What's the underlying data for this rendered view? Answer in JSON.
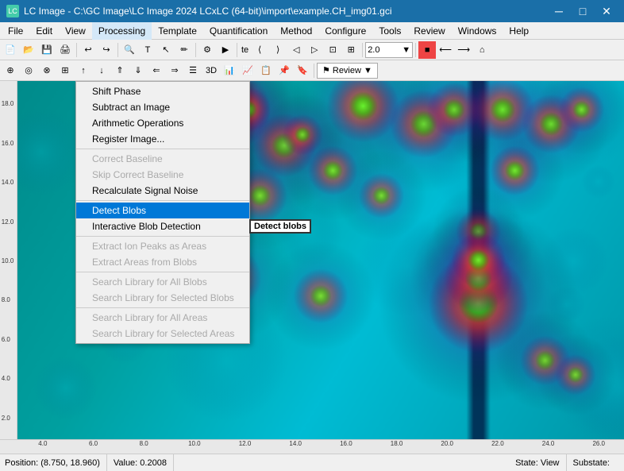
{
  "titlebar": {
    "title": "LC Image - C:\\GC Image\\LC Image 2024 LCxLC (64-bit)\\import\\example.CH_img01.gci",
    "icon": "LC",
    "minimize": "─",
    "maximize": "□",
    "close": "✕"
  },
  "menubar": {
    "items": [
      "File",
      "Edit",
      "View",
      "Processing",
      "Template",
      "Quantification",
      "Method",
      "Configure",
      "Tools",
      "Review",
      "Windows",
      "Help"
    ]
  },
  "toolbar": {
    "zoom_value": "2.0",
    "review_label": "Review"
  },
  "processing_menu": {
    "title": "Processing",
    "sections": [
      {
        "items": [
          {
            "label": "Shift Phase",
            "disabled": false
          },
          {
            "label": "Subtract an Image",
            "disabled": false
          },
          {
            "label": "Arithmetic Operations",
            "disabled": false
          },
          {
            "label": "Register Image...",
            "disabled": false
          }
        ]
      },
      {
        "items": [
          {
            "label": "Correct Baseline",
            "disabled": true
          },
          {
            "label": "Skip Correct Baseline",
            "disabled": true
          },
          {
            "label": "Recalculate Signal Noise",
            "disabled": false
          }
        ]
      },
      {
        "items": [
          {
            "label": "Detect Blobs",
            "disabled": false,
            "highlighted": true
          },
          {
            "label": "Interactive Blob Detection",
            "disabled": false,
            "tooltip": "Detect blobs"
          }
        ]
      },
      {
        "items": [
          {
            "label": "Extract Ion Peaks as Areas",
            "disabled": true
          },
          {
            "label": "Extract Areas from Blobs",
            "disabled": true
          }
        ]
      },
      {
        "items": [
          {
            "label": "Search Library for All Blobs",
            "disabled": true
          },
          {
            "label": "Search Library for Selected Blobs",
            "disabled": true
          }
        ]
      },
      {
        "items": [
          {
            "label": "Search Library for All Areas",
            "disabled": true
          },
          {
            "label": "Search Library for Selected Areas",
            "disabled": true
          }
        ]
      }
    ]
  },
  "statusbar": {
    "position": "Position: (8.750, 18.960)",
    "value": "Value: 0.2008",
    "state": "State: View",
    "substate": "Substate:"
  },
  "ruler": {
    "x_ticks": [
      "4.0",
      "6.0",
      "8.0",
      "10.0",
      "12.0",
      "14.0",
      "16.0",
      "18.0",
      "20.0",
      "22.0",
      "24.0",
      "26.0"
    ],
    "y_ticks": [
      "18.0",
      "16.0",
      "14.0",
      "12.0",
      "10.0",
      "8.0",
      "6.0",
      "4.0",
      "2.0"
    ]
  }
}
